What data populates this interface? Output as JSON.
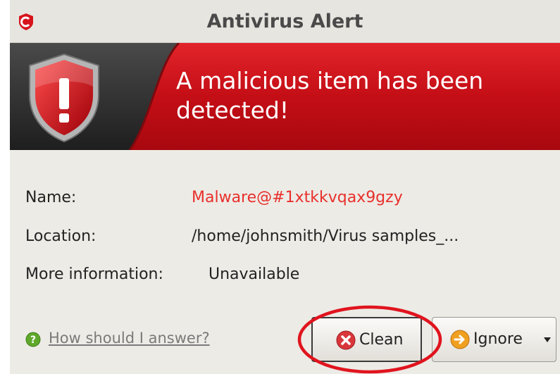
{
  "window": {
    "title": "Antivirus Alert",
    "headline": "A malicious item has been detected!"
  },
  "details": {
    "name_label": "Name:",
    "name_value": "Malware@#1xtkkvqax9gzy",
    "location_label": "Location:",
    "location_value": "/home/johnsmith/Virus samples_...",
    "more_info_label": "More information:",
    "more_info_value": "Unavailable"
  },
  "footer": {
    "help_link": "How should I answer?",
    "clean_label": "Clean",
    "ignore_label": "Ignore"
  },
  "icons": {
    "app_logo": "comodo-logo-icon",
    "alert_shield": "shield-exclamation-icon",
    "help": "help-question-icon",
    "clean": "clean-x-icon",
    "ignore": "ignore-arrow-icon",
    "dropdown": "caret-down-icon"
  },
  "colors": {
    "banner_red": "#c8101a",
    "banner_dark": "#2e2e2e",
    "name_value_red": "#e8302c",
    "annotation_circle": "#e0141e"
  }
}
